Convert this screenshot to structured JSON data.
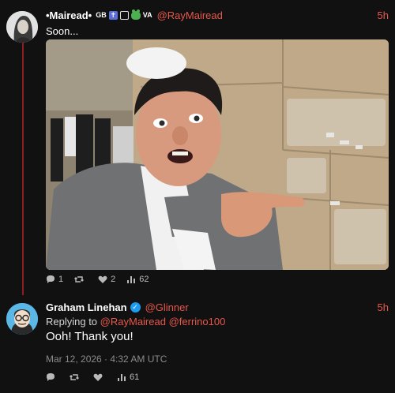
{
  "colors": {
    "background": "#111111",
    "accent": "#e8574a",
    "thread": "#8c1f1f",
    "verified": "#1d9bf0"
  },
  "tweet1": {
    "name": "•Mairead•",
    "flag_text": "GB",
    "flag_text2": "VA",
    "handle": "@RayMairead",
    "time": "5h",
    "text": "Soon...",
    "media_description_icon": "photo",
    "actions": {
      "reply_count": "1",
      "retweet_count": "",
      "like_count": "2",
      "view_count": "62"
    }
  },
  "tweet2": {
    "name": "Graham Linehan",
    "handle": "@Glinner",
    "time": "5h",
    "reply_prefix": "Replying to",
    "reply_mention1": "@RayMairead",
    "reply_mention2": "@ferrino100",
    "text": "Ooh! Thank you!",
    "date": "Mar 12, 2026 · 4:32 AM UTC",
    "actions": {
      "reply_count": "",
      "retweet_count": "",
      "like_count": "",
      "view_count": "61"
    }
  }
}
